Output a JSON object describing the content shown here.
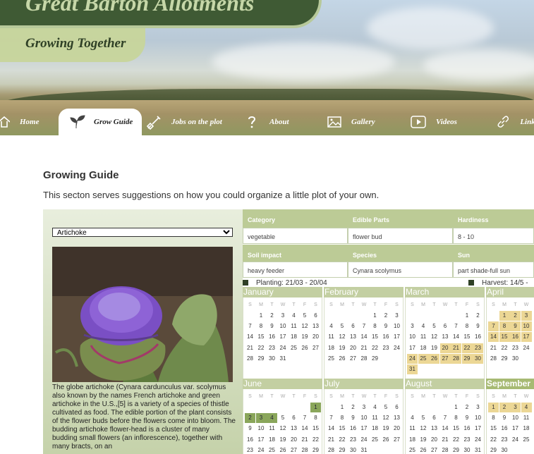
{
  "site": {
    "title": "Great Barton Allotments",
    "tagline": "Growing Together"
  },
  "nav": [
    {
      "label": "Home",
      "icon": "home-icon"
    },
    {
      "label": "Grow Guide",
      "icon": "sprout-icon"
    },
    {
      "label": "Jobs on the plot",
      "icon": "shovel-icon"
    },
    {
      "label": "About",
      "icon": "question-icon"
    },
    {
      "label": "Gallery",
      "icon": "image-icon"
    },
    {
      "label": "Videos",
      "icon": "play-icon"
    },
    {
      "label": "Links",
      "icon": "link-icon"
    }
  ],
  "main": {
    "heading": "Growing Guide",
    "intro": "This secton serves suggestions on how you could organize a little plot of your own."
  },
  "plant": {
    "selected": "Artichoke",
    "description": "The globe artichoke (Cynara cardunculus var. scolymus also known by the names French artichoke and green artichoke in the U.S.,[5] is a variety of a species of thistle cultivated as food. The edible portion of the plant consists of the flower buds before the flowers come into bloom. The budding artichoke flower-head is a cluster of many budding small flowers (an inflorescence), together with many bracts, on an"
  },
  "info": {
    "category_label": "Category",
    "category": "vegetable",
    "edible_label": "Edible Parts",
    "edible": "flower bud",
    "hardiness_label": "Hardiness",
    "hardiness": "8 - 10",
    "soil_label": "Soil impact",
    "soil": "heavy feeder",
    "species_label": "Species",
    "species": "Cynara scolymus",
    "sun_label": "Sun",
    "sun": "part shade-full sun"
  },
  "legend": {
    "planting": "Planting: 21/03 - 20/04",
    "harvest": "Harvest: 14/5 -"
  },
  "weekdays": [
    "S",
    "M",
    "T",
    "W",
    "T",
    "F",
    "S"
  ],
  "colors": {
    "planting": "#8aa65b",
    "harvest": "#ecd795",
    "header": "#bccb96"
  },
  "months": [
    {
      "name": "January",
      "start": 1,
      "days": 31,
      "planting": [],
      "harvest": []
    },
    {
      "name": "February",
      "start": 4,
      "days": 29,
      "planting": [],
      "harvest": []
    },
    {
      "name": "March",
      "start": 5,
      "days": 31,
      "planting": [],
      "harvest": [
        20,
        21,
        22,
        23,
        24,
        25,
        26,
        27,
        28,
        29,
        30,
        31
      ]
    },
    {
      "name": "April",
      "start": 1,
      "days": 30,
      "planting": [],
      "harvest": [
        1,
        2,
        3,
        7,
        8,
        9,
        10,
        14,
        15,
        16,
        17
      ]
    },
    {
      "name": "June",
      "start": 6,
      "days": 30,
      "planting": [
        1,
        2,
        3,
        4
      ],
      "harvest": []
    },
    {
      "name": "July",
      "start": 1,
      "days": 31,
      "planting": [],
      "harvest": []
    },
    {
      "name": "August",
      "start": 4,
      "days": 31,
      "planting": [],
      "harvest": []
    },
    {
      "name": "September",
      "start": 0,
      "days": 30,
      "planting": [],
      "harvest": [
        1,
        2,
        3,
        4
      ]
    }
  ]
}
